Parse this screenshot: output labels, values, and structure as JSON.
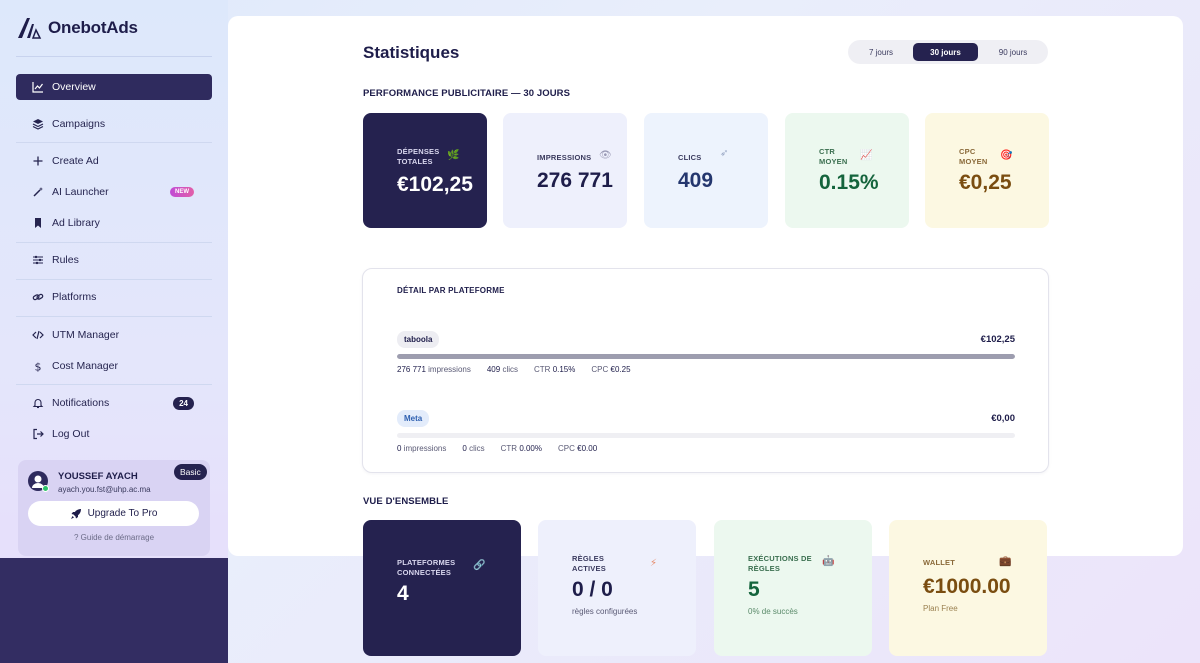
{
  "brand": {
    "name": "OnebotAds"
  },
  "sidebar": {
    "items": [
      {
        "label": "Overview",
        "icon": "chart-line-icon"
      },
      {
        "label": "Campaigns",
        "icon": "layers-icon"
      },
      {
        "label": "Create Ad",
        "icon": "plus-icon"
      },
      {
        "label": "AI Launcher",
        "icon": "magic-wand-icon",
        "badge": "NEW"
      },
      {
        "label": "Ad Library",
        "icon": "bookmark-icon"
      },
      {
        "label": "Rules",
        "icon": "sliders-icon"
      },
      {
        "label": "Platforms",
        "icon": "link-icon"
      },
      {
        "label": "UTM Manager",
        "icon": "code-icon"
      },
      {
        "label": "Cost Manager",
        "icon": "dollar-icon"
      },
      {
        "label": "Notifications",
        "icon": "bell-icon",
        "badge": "24"
      },
      {
        "label": "Log Out",
        "icon": "logout-icon"
      }
    ],
    "user": {
      "name": "YOUSSEF AYACH",
      "email": "ayach.you.fst@uhp.ac.ma",
      "plan": "Basic",
      "upgrade_label": "Upgrade To Pro",
      "guide_label": "? Guide de démarrage"
    }
  },
  "header": {
    "title": "Statistiques",
    "ranges": [
      "7 jours",
      "30 jours",
      "90 jours"
    ],
    "active_range": "30 jours"
  },
  "performance": {
    "title": "PERFORMANCE PUBLICITAIRE — 30 JOURS",
    "kpis": [
      {
        "label_line1": "DÉPENSES",
        "label_line2": "TOTALES",
        "value": "€102,25",
        "icon": "money-icon"
      },
      {
        "label_line1": "IMPRESSIONS",
        "label_line2": "",
        "value": "276 771",
        "icon": "eye-icon"
      },
      {
        "label_line1": "CLICS",
        "label_line2": "",
        "value": "409",
        "icon": "cursor-icon"
      },
      {
        "label_line1": "CTR",
        "label_line2": "MOYEN",
        "value": "0.15%",
        "icon": "trend-chart-icon"
      },
      {
        "label_line1": "CPC",
        "label_line2": "MOYEN",
        "value": "€0,25",
        "icon": "target-icon"
      }
    ]
  },
  "detail": {
    "title": "DÉTAIL PAR PLATEFORME",
    "platforms": [
      {
        "name": "taboola",
        "amount": "€102,25",
        "share": 1.0,
        "impressions": "276 771",
        "impressions_label": "impressions",
        "clicks": "409",
        "clicks_label": "clics",
        "ctr_label": "CTR",
        "ctr": "0.15%",
        "cpc_label": "CPC",
        "cpc": "€0.25"
      },
      {
        "name": "Meta",
        "amount": "€0,00",
        "share": 0.0,
        "impressions": "0",
        "impressions_label": "impressions",
        "clicks": "0",
        "clicks_label": "clics",
        "ctr_label": "CTR",
        "ctr": "0.00%",
        "cpc_label": "CPC",
        "cpc": "€0.00"
      }
    ]
  },
  "overview": {
    "title": "VUE D'ENSEMBLE",
    "cards": [
      {
        "label_line1": "PLATEFORMES",
        "label_line2": "CONNECTÉES",
        "value": "4",
        "sub": "",
        "icon": "link-icon"
      },
      {
        "label_line1": "RÈGLES",
        "label_line2": "ACTIVES",
        "value": "0 / 0",
        "sub": "règles configurées",
        "icon": "lightning-icon"
      },
      {
        "label_line1": "EXÉCUTIONS DE",
        "label_line2": "RÈGLES",
        "value": "5",
        "sub": "0% de succès",
        "icon": "robot-icon"
      },
      {
        "label_line1": "WALLET",
        "label_line2": "",
        "value": "€1000.00",
        "sub": "Plan Free",
        "icon": "briefcase-icon"
      }
    ]
  },
  "colors": {
    "brand_dark": "#25224f",
    "success_green": "#14643c",
    "gold": "#7a4d10",
    "online_dot": "#2ec46a"
  }
}
